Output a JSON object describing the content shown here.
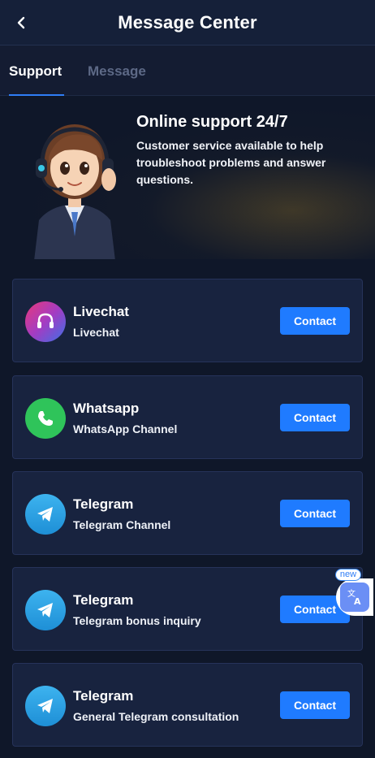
{
  "header": {
    "title": "Message Center",
    "back_icon": "chevron-left-icon"
  },
  "tabs": [
    {
      "label": "Support",
      "active": true
    },
    {
      "label": "Message",
      "active": false
    }
  ],
  "banner": {
    "title": "Online support 24/7",
    "text": "Customer service available to help troubleshoot problems and answer questions."
  },
  "channels": [
    {
      "title": "Livechat",
      "subtitle": "Livechat",
      "icon": "headset-icon",
      "button": "Contact"
    },
    {
      "title": "Whatsapp",
      "subtitle": "WhatsApp Channel",
      "icon": "whatsapp-icon",
      "button": "Contact"
    },
    {
      "title": "Telegram",
      "subtitle": "Telegram Channel",
      "icon": "telegram-icon",
      "button": "Contact"
    },
    {
      "title": "Telegram",
      "subtitle": "Telegram bonus inquiry",
      "icon": "telegram-icon",
      "button": "Contact"
    },
    {
      "title": "Telegram",
      "subtitle": "General Telegram consultation",
      "icon": "telegram-icon",
      "button": "Contact"
    }
  ],
  "translate_widget": {
    "badge": "new",
    "icon": "translate-icon"
  },
  "colors": {
    "background": "#0f1729",
    "card": "#18233f",
    "accent": "#1f7bff",
    "whatsapp": "#2fc45a",
    "telegram": "#2aa3e6"
  }
}
